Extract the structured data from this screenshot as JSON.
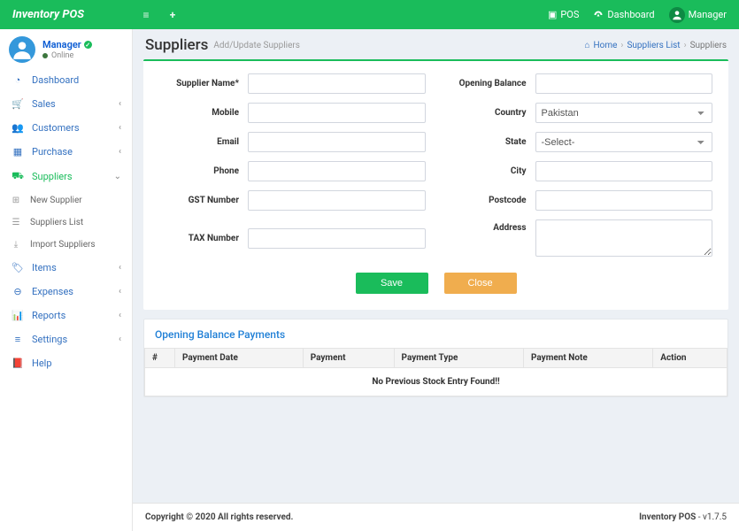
{
  "brand": "Inventory POS",
  "topbar": {
    "pos": "POS",
    "dashboard": "Dashboard",
    "user": "Manager"
  },
  "user": {
    "name": "Manager",
    "status": "Online"
  },
  "nav": {
    "dashboard": "Dashboard",
    "sales": "Sales",
    "customers": "Customers",
    "purchase": "Purchase",
    "suppliers": "Suppliers",
    "new_supplier": "New Supplier",
    "suppliers_list": "Suppliers List",
    "import_suppliers": "Import Suppliers",
    "items": "Items",
    "expenses": "Expenses",
    "reports": "Reports",
    "settings": "Settings",
    "help": "Help"
  },
  "page": {
    "title": "Suppliers",
    "subtitle": "Add/Update Suppliers"
  },
  "breadcrumb": {
    "home": "Home",
    "list": "Suppliers List",
    "current": "Suppliers"
  },
  "form": {
    "labels": {
      "supplier_name": "Supplier Name*",
      "mobile": "Mobile",
      "email": "Email",
      "phone": "Phone",
      "gst": "GST Number",
      "tax": "TAX Number",
      "opening_balance": "Opening Balance",
      "country": "Country",
      "state": "State",
      "city": "City",
      "postcode": "Postcode",
      "address": "Address"
    },
    "values": {
      "supplier_name": "",
      "mobile": "",
      "email": "",
      "phone": "",
      "gst": "",
      "tax": "",
      "opening_balance": "",
      "country": "Pakistan",
      "state": "-Select-",
      "city": "",
      "postcode": "",
      "address": ""
    },
    "buttons": {
      "save": "Save",
      "close": "Close"
    }
  },
  "payments": {
    "title": "Opening Balance Payments",
    "columns": {
      "num": "#",
      "date": "Payment Date",
      "payment": "Payment",
      "type": "Payment Type",
      "note": "Payment Note",
      "action": "Action"
    },
    "empty": "No Previous Stock Entry Found!!"
  },
  "footer": {
    "copyright": "Copyright © 2020 All rights reserved.",
    "product": "Inventory POS",
    "version": " - v1.7.5"
  }
}
